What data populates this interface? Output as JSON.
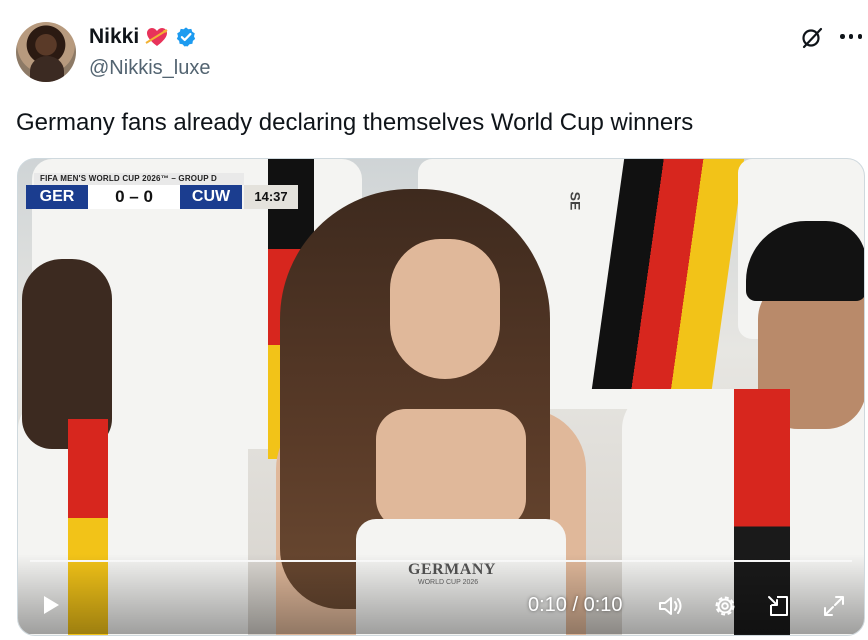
{
  "author": {
    "name": "Nikki",
    "handle": "@Nikkis_luxe",
    "badge_icon": "heart-with-arrow-icon",
    "verified_icon": "verified-badge-icon",
    "verified_color": "#1d9bf0"
  },
  "tweet": {
    "text": "Germany fans already declaring themselves World Cup winners"
  },
  "header_icons": {
    "grok": "grok-icon",
    "more": "more-icon"
  },
  "video": {
    "scorebug": {
      "tournament": "FIFA MEN'S WORLD CUP 2026™ – GROUP D",
      "home": "GER",
      "score": "0 – 0",
      "away": "CUW",
      "clock": "14:37"
    },
    "shirt_text": "GERMANY",
    "shirt_subtext": "WORLD CUP 2026",
    "sleeve_text": "SE",
    "progress": 1.0,
    "time": "0:10 / 0:10",
    "controls": [
      "play-icon",
      "volume-icon",
      "settings-icon",
      "pip-icon",
      "fullscreen-icon"
    ]
  }
}
